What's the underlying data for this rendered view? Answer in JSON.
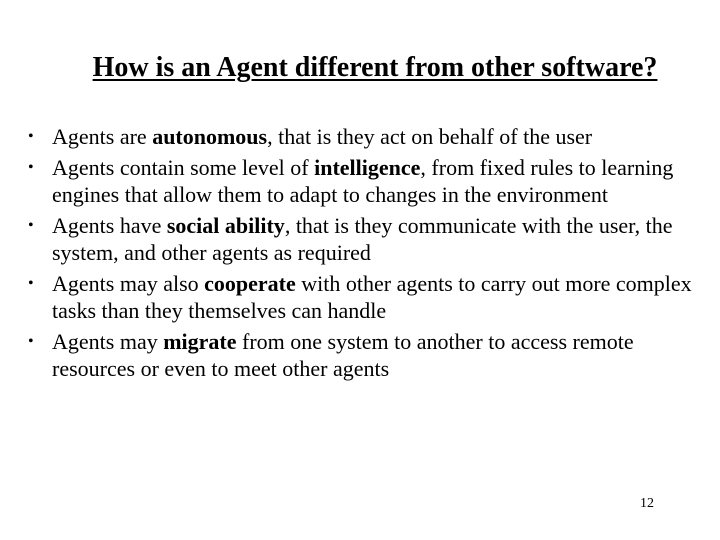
{
  "slide": {
    "title": "How is an Agent different from other software?",
    "bullets": [
      {
        "before": "Agents are ",
        "bold": "autonomous",
        "after": ", that is they act on behalf of the user"
      },
      {
        "before": "Agents contain some level of ",
        "bold": "intelligence",
        "after": ", from fixed rules to learning engines that allow them to adapt to changes in the environment"
      },
      {
        "before": "Agents have ",
        "bold": "social ability",
        "after": ", that is they communicate with the user, the system, and other agents as required"
      },
      {
        "before": "Agents may also ",
        "bold": "cooperate",
        "after": " with other agents to carry out more complex tasks than they themselves can handle"
      },
      {
        "before": "Agents may ",
        "bold": "migrate",
        "after": " from one system to another to access remote resources or even to meet other agents"
      }
    ],
    "bullet_glyph": "•",
    "page_number": "12"
  }
}
